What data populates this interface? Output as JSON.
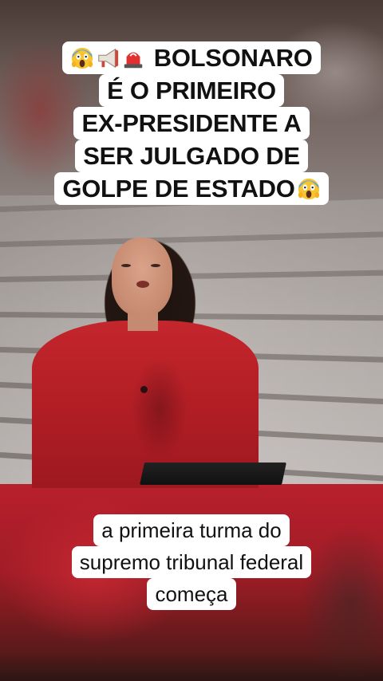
{
  "video": {
    "headline_lines": [
      "BOLSONARO",
      "É O PRIMEIRO",
      "EX-PRESIDENTE A",
      "SER JULGADO DE",
      "GOLPE DE ESTADO"
    ],
    "headline_prefix_icons": [
      "scream-emoji-icon",
      "megaphone-icon",
      "siren-icon"
    ],
    "headline_suffix_icon": "scream-emoji-icon",
    "caption_lines": [
      "a primeira turma do",
      "supremo tribunal federal",
      "começa"
    ]
  },
  "colors": {
    "text_box": "#ffffff",
    "text": "#111111",
    "anchor_outfit": "#c4262c"
  }
}
